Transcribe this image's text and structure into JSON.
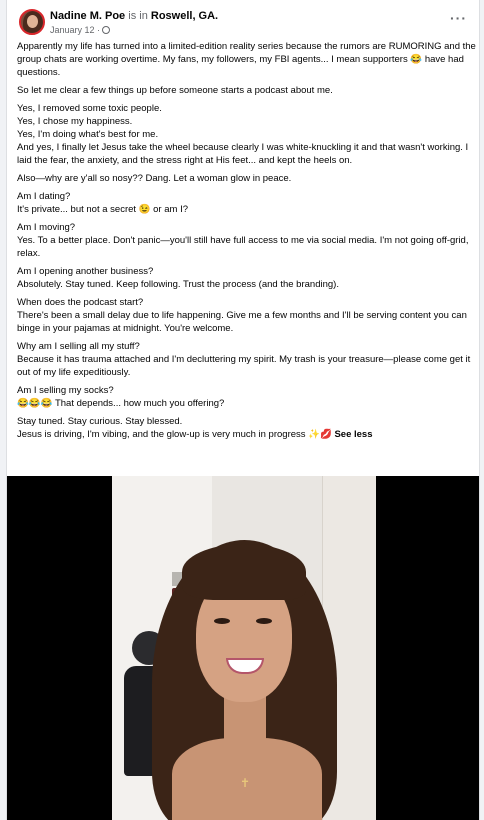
{
  "post": {
    "author": "Nadine M. Poe",
    "is_in": "is in",
    "location": "Roswell, GA.",
    "date": "January 12 ·",
    "more_label": "···"
  },
  "paragraphs": [
    [
      "Apparently my life has turned into a limited-edition reality series because the rumors are RUMORING and the group chats are working overtime. My fans, my followers, my FBI agents... I mean supporters 😂 have had questions."
    ],
    [
      "So let me clear a few things up before someone starts a podcast about me."
    ],
    [
      "Yes, I removed some toxic people.",
      "Yes, I chose my happiness.",
      "Yes, I'm doing what's best for me.",
      "And yes, I finally let Jesus take the wheel because clearly I was white-knuckling it and that wasn't working. I laid the fear, the anxiety, and the stress right at His feet... and kept the heels on."
    ],
    [
      "Also—why are y'all so nosy?? Dang. Let a woman glow in peace."
    ],
    [
      "Am I dating?",
      "It's private... but not a secret 😉 or am I?"
    ],
    [
      "Am I moving?",
      "Yes. To a better place. Don't panic—you'll still have full access to me via social media. I'm not going off-grid, relax."
    ],
    [
      "Am I opening another business?",
      "Absolutely. Stay tuned. Keep following. Trust the process (and the branding)."
    ],
    [
      "When does the podcast start?",
      "There's been a small delay due to life happening. Give me a few months and I'll be serving content you can binge in your pajamas at midnight. You're welcome."
    ],
    [
      "Why am I selling all my stuff?",
      "Because it has trauma attached and I'm decluttering my spirit. My trash is your treasure—please come get it out of my life expeditiously."
    ],
    [
      "Am I selling my socks?",
      "😂😂😂 That depends... how much you offering?"
    ]
  ],
  "closing": {
    "line1": "Stay tuned. Stay curious. Stay blessed.",
    "line2": "Jesus is driving, I'm vibing, and the glow-up is very much in progress ✨💋",
    "see_less": "See less"
  },
  "icons": {
    "avatar": "profile-photo",
    "privacy": "globe-icon",
    "menu": "more-options-icon"
  },
  "colors": {
    "secondary_text": "#65676b",
    "avatar_ring": "#d9262b",
    "media_background": "#000000"
  }
}
